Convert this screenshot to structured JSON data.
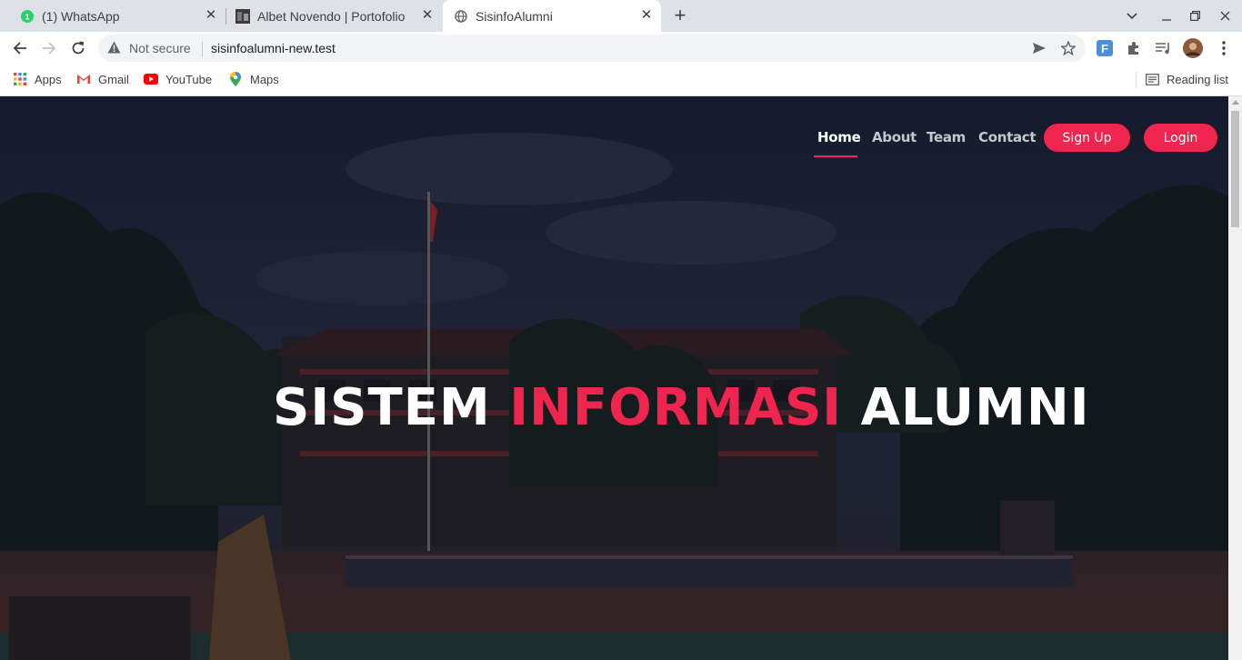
{
  "tabs": [
    {
      "title": "(1) WhatsApp",
      "badge": "1"
    },
    {
      "title": "Albet Novendo | Portofolio"
    },
    {
      "title": "SisinfoAlumni"
    }
  ],
  "omnibox": {
    "security": "Not secure",
    "url": "sisinfoalumni-new.test"
  },
  "bookmarks": [
    {
      "label": "Apps"
    },
    {
      "label": "Gmail"
    },
    {
      "label": "YouTube"
    },
    {
      "label": "Maps"
    }
  ],
  "reading_list": "Reading list",
  "site": {
    "nav": [
      {
        "label": "Home"
      },
      {
        "label": "About"
      },
      {
        "label": "Team"
      },
      {
        "label": "Contact"
      }
    ],
    "signup_label": "Sign Up",
    "login_label": "Login",
    "hero": {
      "part1": "SISTEM",
      "part2": "INFORMASI",
      "part3": "ALUMNI"
    }
  },
  "colors": {
    "accent": "#f0254f",
    "tab_strip": "#dee1e6"
  }
}
